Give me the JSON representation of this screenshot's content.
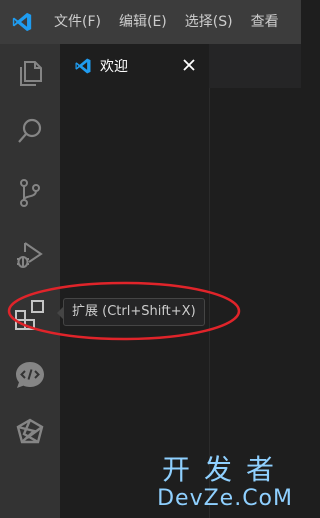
{
  "titlebar": {
    "logo": "vscode-logo",
    "menu": [
      {
        "label": "文件(F)"
      },
      {
        "label": "编辑(E)"
      },
      {
        "label": "选择(S)"
      },
      {
        "label": "查看"
      }
    ]
  },
  "activitybar": {
    "items": [
      {
        "icon": "files-icon"
      },
      {
        "icon": "search-icon"
      },
      {
        "icon": "source-control-icon"
      },
      {
        "icon": "run-debug-icon"
      },
      {
        "icon": "extensions-icon"
      },
      {
        "icon": "code-chat-icon"
      },
      {
        "icon": "extension-logo-icon"
      }
    ]
  },
  "editor": {
    "tabs": [
      {
        "label": "欢迎",
        "icon": "vscode-logo",
        "close": "×"
      }
    ]
  },
  "tooltip": {
    "text": "扩展 (Ctrl+Shift+X)"
  },
  "watermark": {
    "top": "开发者",
    "bottom": "DevZe.CoM"
  },
  "colors": {
    "accent": "#1f9cf0",
    "annotation": "#e0242a",
    "watermark": "#8fd0ff"
  }
}
